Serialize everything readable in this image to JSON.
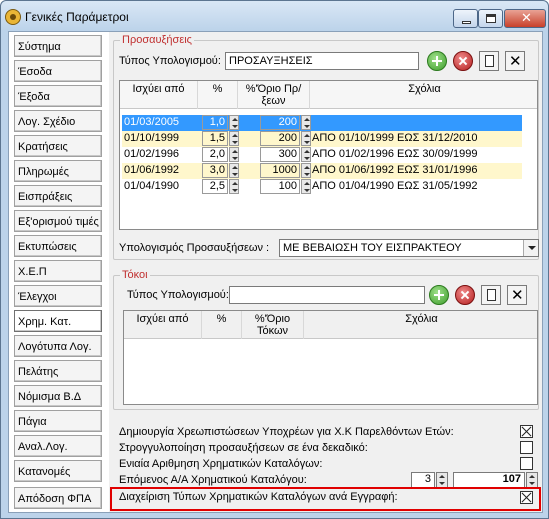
{
  "window": {
    "title": "Γενικές Παράμετροι"
  },
  "sidebar": {
    "items": [
      {
        "label": "Σύστημα"
      },
      {
        "label": "Έσοδα"
      },
      {
        "label": "Έξοδα"
      },
      {
        "label": "Λογ. Σχέδιο"
      },
      {
        "label": "Κρατήσεις"
      },
      {
        "label": "Πληρωμές"
      },
      {
        "label": "Εισπράξεις"
      },
      {
        "label": "Εξ'ορισμού τιμές"
      },
      {
        "label": "Εκτυπώσεις"
      },
      {
        "label": "Χ.Ε.Π"
      },
      {
        "label": "Έλεγχοι"
      },
      {
        "label": "Χρημ. Κατ."
      },
      {
        "label": "Λογότυπα Λογ."
      },
      {
        "label": "Πελάτης"
      },
      {
        "label": "Νόμισμα Β.Δ"
      },
      {
        "label": "Πάγια"
      },
      {
        "label": "Αναλ.Λογ."
      },
      {
        "label": "Κατανομές"
      },
      {
        "label": "Απόδοση ΦΠΑ"
      }
    ],
    "active_index": 11
  },
  "increases": {
    "group_title": "Προσαυξήσεις",
    "type_label": "Τύπος Υπολογισμού:",
    "type_value": "ΠΡΟΣΑΥΞΗΣΕΙΣ",
    "columns": {
      "start": "Ισχύει από",
      "pct": "%",
      "ceiling": "%'Όριο Πρ/ξεων",
      "comments": "Σχόλια"
    },
    "rows": [
      {
        "date": "01/03/2005",
        "pct": "1,0",
        "ceiling": "200",
        "comment": "",
        "state": "selected"
      },
      {
        "date": "01/10/1999",
        "pct": "1,5",
        "ceiling": "200",
        "comment": "ΑΠΟ 01/10/1999  ΕΩΣ 31/12/2010",
        "state": "yellow"
      },
      {
        "date": "01/02/1996",
        "pct": "2,0",
        "ceiling": "300",
        "comment": "ΑΠΟ 01/02/1996 ΕΩΣ 30/09/1999",
        "state": "normal"
      },
      {
        "date": "01/06/1992",
        "pct": "3,0",
        "ceiling": "1000",
        "comment": "ΑΠΟ 01/06/1992 ΕΩΣ 31/01/1996",
        "state": "yellow"
      },
      {
        "date": "01/04/1990",
        "pct": "2,5",
        "ceiling": "100",
        "comment": "ΑΠΟ 01/04/1990 ΕΩΣ 31/05/1992",
        "state": "normal"
      }
    ],
    "calc_label": "Υπολογισμός Προσαυξήσεων :",
    "calc_value": "ΜΕ ΒΕΒΑΙΩΣΗ ΤΟΥ ΕΙΣΠΡΑΚΤΕΟΥ"
  },
  "interest": {
    "group_title": "Τόκοι",
    "type_label": "Τύπος Υπολογισμού:",
    "type_value": "",
    "columns": {
      "start": "Ισχύει από",
      "pct": "%",
      "ceiling": "%'Όριο Τόκων",
      "comments": "Σχόλια"
    }
  },
  "options": {
    "create_debts": "Δημιουργία Χρεωπιστώσεων Υποχρέων για Χ.Κ Παρελθόντων Ετών:",
    "rounding": "Στρογγυλοποίηση προσαυξήσεων σε ένα δεκαδικό:",
    "unified_numbering": "Ενιαία Αριθμηση Χρηματικών Καταλόγων:",
    "next_aa": "Επόμενος Α/Α Χρηματικού Καταλόγου:",
    "next_aa_prefix": "3",
    "next_aa_value": "107",
    "manage_types": "Διαχείριση Τύπων Χρηματικών Καταλόγων ανά Εγγραφή:"
  }
}
